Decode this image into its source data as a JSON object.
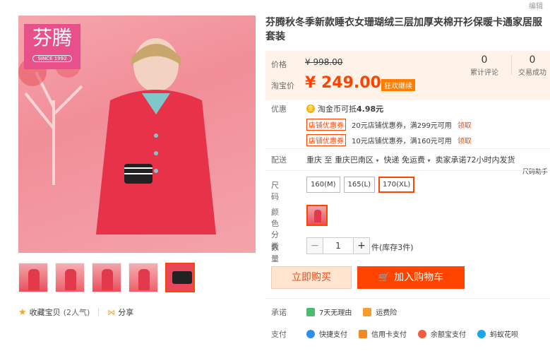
{
  "edit_link": "编辑",
  "brand": {
    "logo_cn": "芬腾",
    "logo_since": "SINCE 1992"
  },
  "title": "芬腾秋冬季新款睡衣女珊瑚绒三层加厚夹棉开衫保暖卡通家居服套装",
  "price": {
    "orig_label": "价格",
    "orig_value": "¥ 998.00",
    "now_label": "淘宝价",
    "now_value": "¥ 249.00",
    "badge": "狂欢继续",
    "reviews_count": "0",
    "reviews_label": "累计评论",
    "sales_count": "0",
    "sales_label": "交易成功"
  },
  "promo": {
    "label": "优惠",
    "coin_text": "淘金币可抵",
    "coin_amount": "4.98元",
    "coupons": [
      {
        "tag": "店铺优惠券",
        "text": "20元店铺优惠券，满299元可用",
        "action": "领取"
      },
      {
        "tag": "店铺优惠券",
        "text": "10元店铺优惠券，满160元可用",
        "action": "领取"
      }
    ]
  },
  "shipping": {
    "label": "配送",
    "from": "重庆 至",
    "to": "重庆巴南区",
    "method": "快递 免运费",
    "promise": "卖家承诺72小时内发货"
  },
  "size_helper": "尺码助手",
  "size": {
    "label": "尺码",
    "options": [
      "160(M)",
      "165(L)",
      "170(XL)"
    ],
    "selected": "170(XL)"
  },
  "color": {
    "label": "颜色分类"
  },
  "quantity": {
    "label": "数量",
    "value": "1",
    "minus": "−",
    "plus": "+",
    "stock": "件(库存3件)"
  },
  "buttons": {
    "buy_now": "立即购买",
    "add_cart": "加入购物车"
  },
  "favorite": {
    "label": "收藏宝贝",
    "count": "(2人气)",
    "share": "分享"
  },
  "promise": {
    "label": "承诺",
    "items": [
      "7天无理由",
      "运费险"
    ]
  },
  "payment": {
    "label": "支付",
    "items": [
      "快捷支付",
      "信用卡支付",
      "余额宝支付",
      "蚂蚁花呗"
    ]
  },
  "colors": {
    "accent": "#ff4400",
    "price_bg": "#fff2e8",
    "buy_bg": "#ffe4d0"
  }
}
